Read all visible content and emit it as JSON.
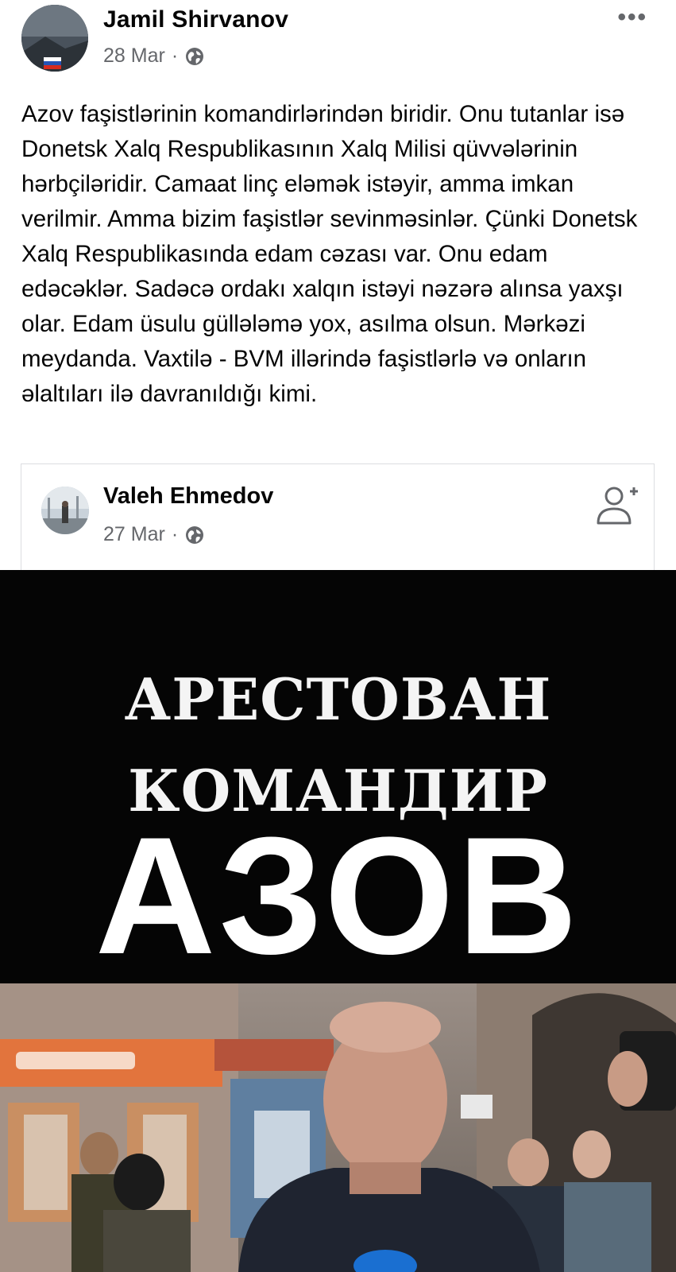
{
  "post": {
    "author": "Jamil Shirvanov",
    "date": "28 Mar",
    "separator": "·",
    "text": "Azov faşistlərinin komandirlərindən biridir. Onu tutanlar isə Donetsk Xalq Respublikasının Xalq Milisi qüvvələrinin hərbçiləridir. Camaat linç eləmək istəyir, amma imkan verilmir. Amma bizim faşistlər sevinməsinlər. Çünki Donetsk Xalq Respublikasında edam cəzası var. Onu edam edəcəklər. Sadəcə ordakı xalqın istəyi nəzərə alınsa yaxşı olar. Edam üsulu güllələmə yox, asılma olsun. Mərkəzi meydanda. Vaxtilə - BVM illərində faşistlərlə və onların əlaltıları ilə davranıldığı kimi.",
    "more_icon": "more-horizontal-icon",
    "privacy_icon": "globe-icon"
  },
  "shared": {
    "author": "Valeh Ehmedov",
    "date": "27 Mar",
    "separator": "·",
    "privacy_icon": "globe-icon",
    "action_icon": "add-friend-icon"
  },
  "video": {
    "line1": "АРЕСТОВАН",
    "line2": "КОМАНДИР",
    "line3": "АЗОВ"
  },
  "colors": {
    "text": "#050505",
    "secondary": "#65676b",
    "video_bg": "#050505"
  }
}
